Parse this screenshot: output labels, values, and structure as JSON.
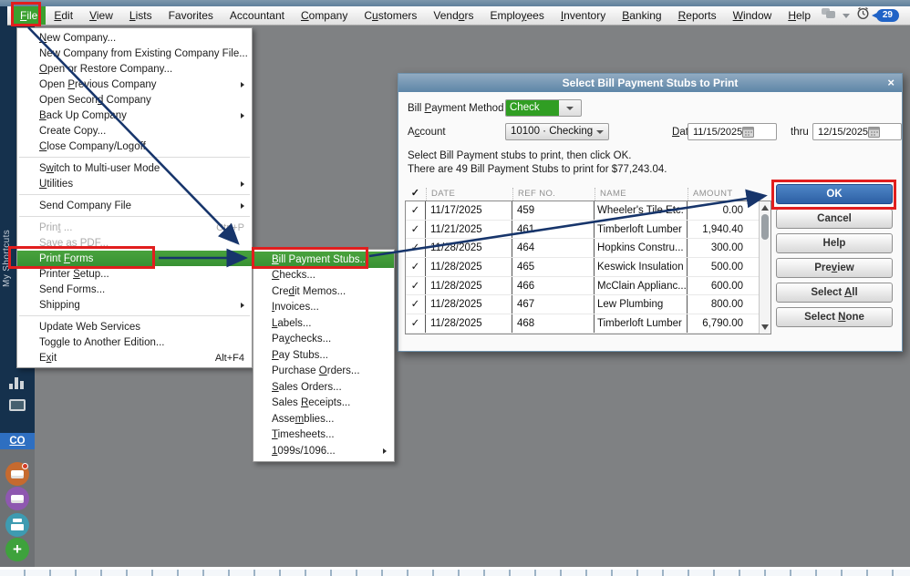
{
  "menubar": {
    "items": [
      {
        "label": "File",
        "u": 0,
        "active": true
      },
      {
        "label": "Edit",
        "u": 0
      },
      {
        "label": "View",
        "u": 0
      },
      {
        "label": "Lists",
        "u": 0
      },
      {
        "label": "Favorites",
        "u": -1
      },
      {
        "label": "Accountant",
        "u": -1
      },
      {
        "label": "Company",
        "u": 0
      },
      {
        "label": "Customers",
        "u": 1
      },
      {
        "label": "Vendors",
        "u": 4
      },
      {
        "label": "Employees",
        "u": 5
      },
      {
        "label": "Inventory",
        "u": 0
      },
      {
        "label": "Banking",
        "u": 0
      },
      {
        "label": "Reports",
        "u": 0
      },
      {
        "label": "Window",
        "u": 0
      },
      {
        "label": "Help",
        "u": 0
      }
    ],
    "right": {
      "reminders_count": "29"
    }
  },
  "sidebar": {
    "shortcuts_label": "My Shortcuts",
    "co_shortcut": "CO",
    "icons": [
      "bar-chart",
      "window",
      "contacts",
      "payment-card",
      "printer",
      "add"
    ]
  },
  "file_menu": {
    "items": [
      {
        "label": "New Company...",
        "u": 0
      },
      {
        "label": "New Company from Existing Company File...",
        "u": -1
      },
      {
        "label": "Open or Restore Company...",
        "u": 0
      },
      {
        "label": "Open Previous Company",
        "u": 5,
        "submenu": true
      },
      {
        "label": "Open Second Company",
        "u": 10
      },
      {
        "label": "Back Up Company",
        "u": 0,
        "submenu": true
      },
      {
        "label": "Create Copy...",
        "u": -1
      },
      {
        "label": "Close Company/Logoff",
        "u": 0
      },
      {
        "sep": true
      },
      {
        "label": "Switch to Multi-user Mode",
        "u": 1
      },
      {
        "label": "Utilities",
        "u": 0,
        "submenu": true
      },
      {
        "sep": true
      },
      {
        "label": "Send Company File",
        "u": -1,
        "submenu": true
      },
      {
        "sep": true
      },
      {
        "label": "Print ...",
        "u": 4,
        "disabled": true,
        "shortcut": "Ctrl+P"
      },
      {
        "label": "Save as PDF...",
        "u": -1,
        "disabled": true
      },
      {
        "label": "Print Forms",
        "u": 6,
        "highlight": true
      },
      {
        "label": "Printer Setup...",
        "u": 8
      },
      {
        "label": "Send Forms...",
        "u": -1
      },
      {
        "label": "Shipping",
        "u": 7,
        "submenu": true
      },
      {
        "sep": true
      },
      {
        "label": "Update Web Services",
        "u": -1
      },
      {
        "label": "Toggle to Another Edition...",
        "u": -1
      },
      {
        "label": "Exit",
        "u": 1,
        "shortcut": "Alt+F4"
      }
    ]
  },
  "print_forms_submenu": {
    "items": [
      {
        "label": "Bill Payment Stubs...",
        "u": 0,
        "highlight": true
      },
      {
        "label": "Checks...",
        "u": 0
      },
      {
        "label": "Credit Memos...",
        "u": 3
      },
      {
        "label": "Invoices...",
        "u": 0
      },
      {
        "label": "Labels...",
        "u": 0
      },
      {
        "label": "Paychecks...",
        "u": 2
      },
      {
        "label": "Pay Stubs...",
        "u": 0
      },
      {
        "label": "Purchase Orders...",
        "u": 9
      },
      {
        "label": "Sales Orders...",
        "u": 0
      },
      {
        "label": "Sales Receipts...",
        "u": 6
      },
      {
        "label": "Assemblies...",
        "u": 4
      },
      {
        "label": "Timesheets...",
        "u": 0
      },
      {
        "label": "1099s/1096...",
        "u": 0,
        "submenu": true
      }
    ]
  },
  "dialog": {
    "title": "Select Bill Payment Stubs to Print",
    "close": "×",
    "method_label": {
      "label": "Bill Payment Method",
      "u": 5
    },
    "method_value": "Check",
    "account_label": {
      "label": "Account",
      "u": 1
    },
    "account_value": "10100 · Checking",
    "dated_label": {
      "label": "Dated",
      "u": 0
    },
    "date_from": "11/15/2025",
    "thru_label": "thru",
    "date_to": "12/15/2025",
    "instruction1": "Select Bill Payment stubs to print, then click OK.",
    "instruction2": "There are 49 Bill Payment Stubs to print for $77,243.04.",
    "table": {
      "columns": [
        "✓",
        "DATE",
        "REF NO.",
        "NAME",
        "AMOUNT"
      ],
      "rows": [
        {
          "checked": "✓",
          "date": "11/17/2025",
          "ref": "459",
          "name": "Wheeler's Tile Etc.",
          "amount": "0.00"
        },
        {
          "checked": "✓",
          "date": "11/21/2025",
          "ref": "461",
          "name": "Timberloft Lumber",
          "amount": "1,940.40"
        },
        {
          "checked": "✓",
          "date": "11/28/2025",
          "ref": "464",
          "name": "Hopkins Constru...",
          "amount": "300.00"
        },
        {
          "checked": "✓",
          "date": "11/28/2025",
          "ref": "465",
          "name": "Keswick Insulation",
          "amount": "500.00"
        },
        {
          "checked": "✓",
          "date": "11/28/2025",
          "ref": "466",
          "name": "McClain Applianc...",
          "amount": "600.00"
        },
        {
          "checked": "✓",
          "date": "11/28/2025",
          "ref": "467",
          "name": "Lew Plumbing",
          "amount": "800.00"
        },
        {
          "checked": "✓",
          "date": "11/28/2025",
          "ref": "468",
          "name": "Timberloft Lumber",
          "amount": "6,790.00"
        }
      ]
    },
    "buttons": [
      {
        "label": "OK",
        "u": -1,
        "primary": true
      },
      {
        "label": "Cancel",
        "u": -1
      },
      {
        "label": "Help",
        "u": -1
      },
      {
        "label": "Preview",
        "u": 3
      },
      {
        "label": "Select All",
        "u": 7
      },
      {
        "label": "Select None",
        "u": 7
      }
    ]
  },
  "annotations": {
    "highlight_box_color": "#e11e1e",
    "arrow_color": "#17356b",
    "boxes": [
      "file-menu-item",
      "print-forms-item",
      "bill-payment-stubs-item",
      "ok-button"
    ]
  },
  "colors": {
    "menu_highlight_green": "#3ba02f",
    "primary_button_blue": "#2d5fa4",
    "dialog_title_blue": "#6c92b0",
    "sidebar_navy": "#15314d"
  }
}
